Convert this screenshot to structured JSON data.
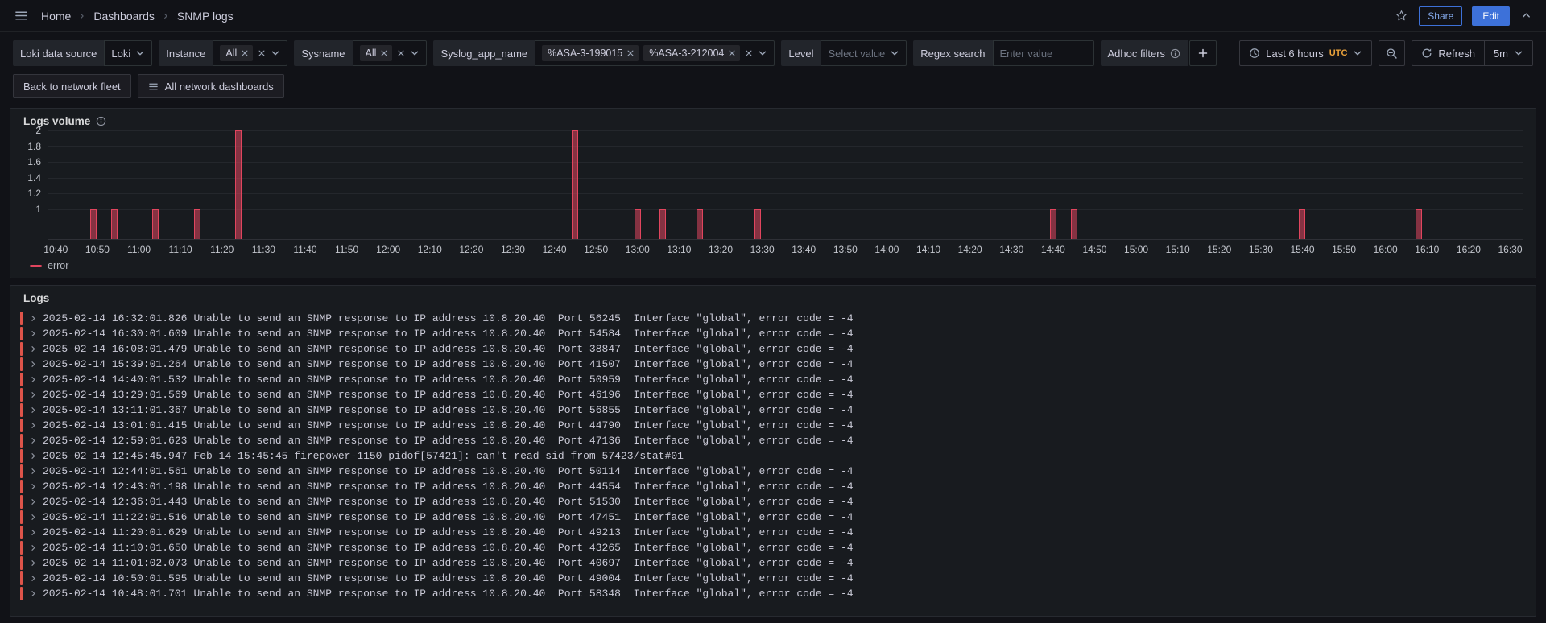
{
  "colors": {
    "primary_blue": "#3D71D9",
    "error_series": "#E0455E",
    "error_series_fill": "rgba(224,69,94,0.55)",
    "log_error_indicator": "#DE544A",
    "timezone_accent": "#E9A13B"
  },
  "nav": {
    "breadcrumb": [
      {
        "label": "Home"
      },
      {
        "label": "Dashboards"
      },
      {
        "label": "SNMP logs"
      }
    ],
    "share_label": "Share",
    "edit_label": "Edit"
  },
  "filters": [
    {
      "label": "Loki data source",
      "type": "select",
      "value": "Loki"
    },
    {
      "label": "Instance",
      "type": "multiselect",
      "tags": [
        "All"
      ]
    },
    {
      "label": "Sysname",
      "type": "multiselect",
      "tags": [
        "All"
      ]
    },
    {
      "label": "Syslog_app_name",
      "type": "multiselect",
      "tags": [
        "%ASA-3-199015",
        "%ASA-3-212004"
      ]
    },
    {
      "label": "Level",
      "type": "select",
      "placeholder": "Select value"
    },
    {
      "label": "Regex search",
      "type": "input",
      "placeholder": "Enter value"
    },
    {
      "label": "Adhoc filters",
      "type": "adhoc",
      "info": true
    }
  ],
  "time_controls": {
    "range_label": "Last 6 hours",
    "timezone": "UTC",
    "refresh_label": "Refresh",
    "interval": "5m"
  },
  "quick_links": [
    {
      "label": "Back to network fleet"
    },
    {
      "label": "All network dashboards"
    }
  ],
  "panels": {
    "logs_volume_title": "Logs volume",
    "logs_title": "Logs"
  },
  "chart_data": {
    "type": "bar",
    "title": "Logs volume",
    "x_range": [
      "10:38",
      "16:33"
    ],
    "ylim": [
      0.62,
      2
    ],
    "y_ticks": [
      "2",
      "1.8",
      "1.6",
      "1.4",
      "1.2",
      "1"
    ],
    "x_ticks": [
      "10:40",
      "10:50",
      "11:00",
      "11:10",
      "11:20",
      "11:30",
      "11:40",
      "11:50",
      "12:00",
      "12:10",
      "12:20",
      "12:30",
      "12:40",
      "12:50",
      "13:00",
      "13:10",
      "13:20",
      "13:30",
      "13:40",
      "13:50",
      "14:00",
      "14:10",
      "14:20",
      "14:30",
      "14:40",
      "14:50",
      "15:00",
      "15:10",
      "15:20",
      "15:30",
      "15:40",
      "15:50",
      "16:00",
      "16:10",
      "16:20",
      "16:30"
    ],
    "grid": true,
    "legend_position": "bottom",
    "series": [
      {
        "name": "error",
        "color": "#E0455E",
        "fill": "rgba(224,69,94,0.55)",
        "points": [
          [
            "10:49",
            1
          ],
          [
            "10:54",
            1
          ],
          [
            "11:04",
            1
          ],
          [
            "11:14",
            1
          ],
          [
            "11:24",
            2
          ],
          [
            "12:45",
            2
          ],
          [
            "13:00",
            1
          ],
          [
            "13:06",
            1
          ],
          [
            "13:15",
            1
          ],
          [
            "13:29",
            1
          ],
          [
            "14:40",
            1
          ],
          [
            "14:45",
            1
          ],
          [
            "15:40",
            1
          ],
          [
            "16:08",
            1
          ]
        ]
      }
    ],
    "legend": [
      {
        "label": "error",
        "color": "#E0455E"
      }
    ]
  },
  "logs": {
    "rows": [
      {
        "time": "2025-02-14 16:32:01.826",
        "level": "error",
        "message": "Unable to send an SNMP response to IP address 10.8.20.40  Port 56245  Interface \"global\", error code = -4"
      },
      {
        "time": "2025-02-14 16:30:01.609",
        "level": "error",
        "message": "Unable to send an SNMP response to IP address 10.8.20.40  Port 54584  Interface \"global\", error code = -4"
      },
      {
        "time": "2025-02-14 16:08:01.479",
        "level": "error",
        "message": "Unable to send an SNMP response to IP address 10.8.20.40  Port 38847  Interface \"global\", error code = -4"
      },
      {
        "time": "2025-02-14 15:39:01.264",
        "level": "error",
        "message": "Unable to send an SNMP response to IP address 10.8.20.40  Port 41507  Interface \"global\", error code = -4"
      },
      {
        "time": "2025-02-14 14:40:01.532",
        "level": "error",
        "message": "Unable to send an SNMP response to IP address 10.8.20.40  Port 50959  Interface \"global\", error code = -4"
      },
      {
        "time": "2025-02-14 13:29:01.569",
        "level": "error",
        "message": "Unable to send an SNMP response to IP address 10.8.20.40  Port 46196  Interface \"global\", error code = -4"
      },
      {
        "time": "2025-02-14 13:11:01.367",
        "level": "error",
        "message": "Unable to send an SNMP response to IP address 10.8.20.40  Port 56855  Interface \"global\", error code = -4"
      },
      {
        "time": "2025-02-14 13:01:01.415",
        "level": "error",
        "message": "Unable to send an SNMP response to IP address 10.8.20.40  Port 44790  Interface \"global\", error code = -4"
      },
      {
        "time": "2025-02-14 12:59:01.623",
        "level": "error",
        "message": "Unable to send an SNMP response to IP address 10.8.20.40  Port 47136  Interface \"global\", error code = -4"
      },
      {
        "time": "2025-02-14 12:45:45.947",
        "level": "error",
        "message": "Feb 14 15:45:45 firepower-1150 pidof[57421]: can't read sid from 57423/stat#01"
      },
      {
        "time": "2025-02-14 12:44:01.561",
        "level": "error",
        "message": "Unable to send an SNMP response to IP address 10.8.20.40  Port 50114  Interface \"global\", error code = -4"
      },
      {
        "time": "2025-02-14 12:43:01.198",
        "level": "error",
        "message": "Unable to send an SNMP response to IP address 10.8.20.40  Port 44554  Interface \"global\", error code = -4"
      },
      {
        "time": "2025-02-14 12:36:01.443",
        "level": "error",
        "message": "Unable to send an SNMP response to IP address 10.8.20.40  Port 51530  Interface \"global\", error code = -4"
      },
      {
        "time": "2025-02-14 11:22:01.516",
        "level": "error",
        "message": "Unable to send an SNMP response to IP address 10.8.20.40  Port 47451  Interface \"global\", error code = -4"
      },
      {
        "time": "2025-02-14 11:20:01.629",
        "level": "error",
        "message": "Unable to send an SNMP response to IP address 10.8.20.40  Port 49213  Interface \"global\", error code = -4"
      },
      {
        "time": "2025-02-14 11:10:01.650",
        "level": "error",
        "message": "Unable to send an SNMP response to IP address 10.8.20.40  Port 43265  Interface \"global\", error code = -4"
      },
      {
        "time": "2025-02-14 11:01:02.073",
        "level": "error",
        "message": "Unable to send an SNMP response to IP address 10.8.20.40  Port 40697  Interface \"global\", error code = -4"
      },
      {
        "time": "2025-02-14 10:50:01.595",
        "level": "error",
        "message": "Unable to send an SNMP response to IP address 10.8.20.40  Port 49004  Interface \"global\", error code = -4"
      },
      {
        "time": "2025-02-14 10:48:01.701",
        "level": "error",
        "message": "Unable to send an SNMP response to IP address 10.8.20.40  Port 58348  Interface \"global\", error code = -4"
      }
    ]
  }
}
